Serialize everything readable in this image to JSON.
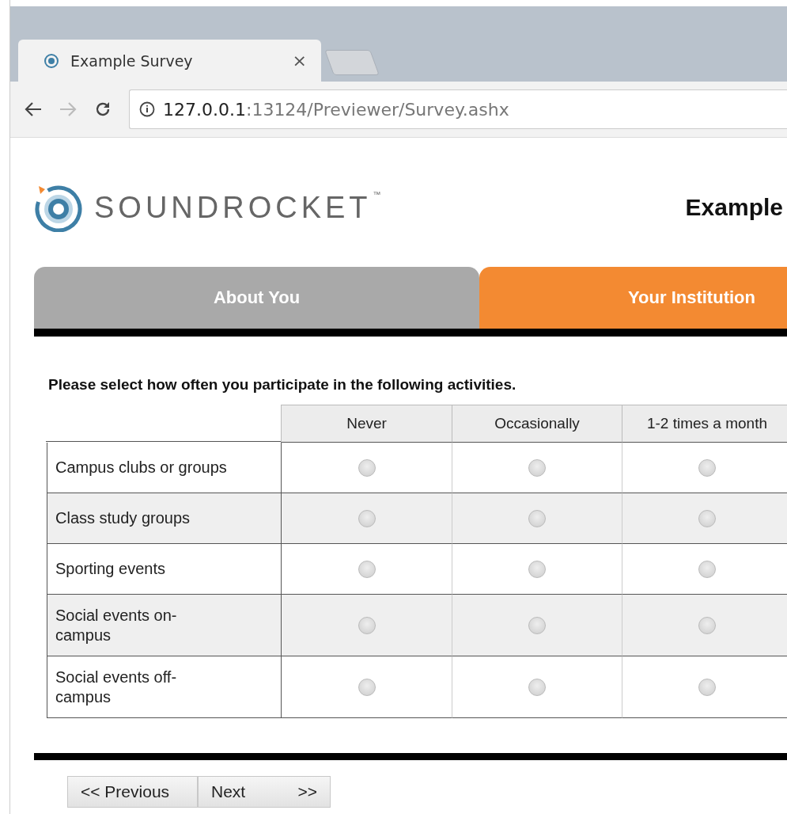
{
  "browser": {
    "tab_title": "Example Survey",
    "tab_close": "×",
    "address_host": "127.0.0.1",
    "address_rest": ":13124/Previewer/Survey.ashx"
  },
  "header": {
    "logo_text": "SOUNDROCKET",
    "trademark": "™",
    "title": "Example"
  },
  "sections": [
    {
      "label": "About You",
      "selected": false
    },
    {
      "label": "Your Institution",
      "selected": true
    }
  ],
  "question": "Please select how often you participate in the following activities.",
  "columns": [
    "Never",
    "Occasionally",
    "1-2 times a month"
  ],
  "rows": [
    {
      "label": "Campus clubs or groups",
      "options": [
        {
          "selected": false
        },
        {
          "selected": false
        },
        {
          "selected": false
        }
      ]
    },
    {
      "label": "Class study groups",
      "options": [
        {
          "selected": false
        },
        {
          "selected": false
        },
        {
          "selected": false
        }
      ]
    },
    {
      "label": "Sporting events",
      "options": [
        {
          "selected": false
        },
        {
          "selected": false
        },
        {
          "selected": false
        }
      ]
    },
    {
      "label": "Social events on-campus",
      "options": [
        {
          "selected": false
        },
        {
          "selected": false
        },
        {
          "selected": false
        }
      ]
    },
    {
      "label": "Social events off-campus",
      "options": [
        {
          "selected": false
        },
        {
          "selected": false
        },
        {
          "selected": false
        }
      ]
    }
  ],
  "nav": {
    "previous": "<< Previous",
    "next": "Next",
    "next_arrow": ">>"
  }
}
